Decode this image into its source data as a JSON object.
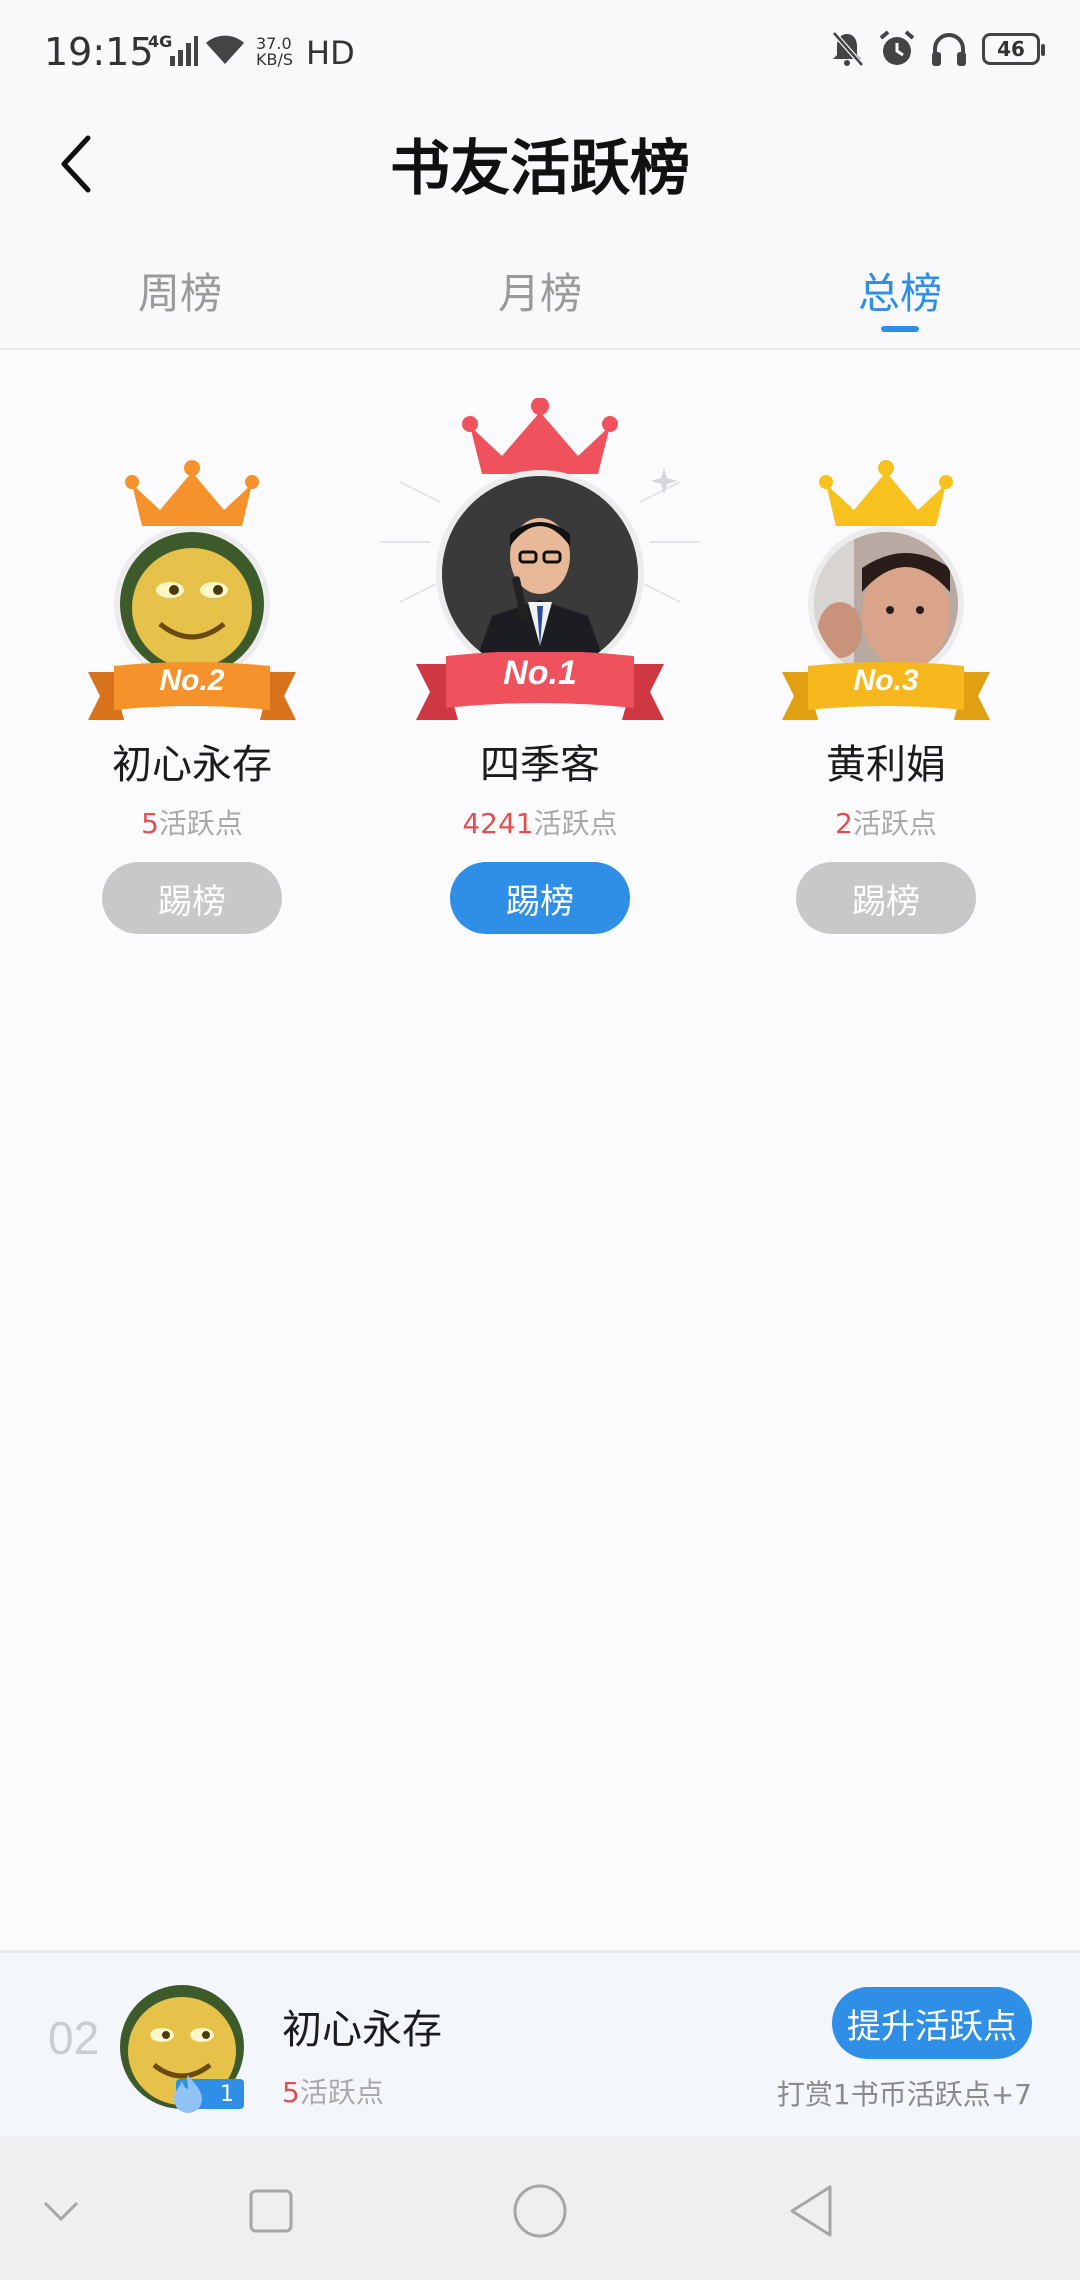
{
  "status_bar": {
    "time": "19:15",
    "network": "4G",
    "speed_value": "37.0",
    "speed_unit": "KB/S",
    "hd": "HD",
    "battery": "46"
  },
  "header": {
    "title": "书友活跃榜",
    "back_icon": "chevron-left-icon"
  },
  "tabs": [
    {
      "label": "周榜",
      "active": false
    },
    {
      "label": "月榜",
      "active": false
    },
    {
      "label": "总榜",
      "active": true
    }
  ],
  "podium": {
    "first": {
      "badge": "No.1",
      "name": "四季客",
      "points": "4241",
      "points_suffix": "活跃点",
      "button": "踢榜",
      "color": "#f0525d"
    },
    "second": {
      "badge": "No.2",
      "name": "初心永存",
      "points": "5",
      "points_suffix": "活跃点",
      "button": "踢榜",
      "color": "#f5922b"
    },
    "third": {
      "badge": "No.3",
      "name": "黄利娟",
      "points": "2",
      "points_suffix": "活跃点",
      "button": "踢榜",
      "color": "#f7b81d"
    }
  },
  "my_rank": {
    "rank": "02",
    "name": "初心永存",
    "points": "5",
    "points_suffix": "活跃点",
    "level": "1",
    "button": "提升活跃点",
    "hint": "打赏1书币活跃点+7"
  },
  "colors": {
    "accent": "#2f8fe6",
    "highlight": "#e05050"
  }
}
